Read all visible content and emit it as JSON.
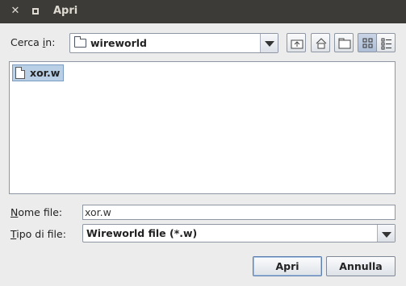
{
  "window": {
    "title": "Apri",
    "close_glyph": "✕"
  },
  "look_in": {
    "label_underlined": "Cerca ",
    "label_underline_char": "i",
    "label_rest": "n:",
    "value": "wireworld"
  },
  "toolbar": {
    "up": "up-folder-icon",
    "home": "home-icon",
    "new_folder": "new-folder-icon",
    "list_view": "list-view-icon",
    "details_view": "details-view-icon"
  },
  "files": [
    {
      "name": "xor.w",
      "icon": "file-icon",
      "selected": true
    }
  ],
  "file_name": {
    "label_first": "N",
    "label_rest": "ome file:",
    "value": "xor.w"
  },
  "file_type": {
    "label_first": "T",
    "label_rest": "ipo di file:",
    "value": "Wireworld file (*.w)"
  },
  "buttons": {
    "open": "Apri",
    "cancel": "Annulla"
  }
}
